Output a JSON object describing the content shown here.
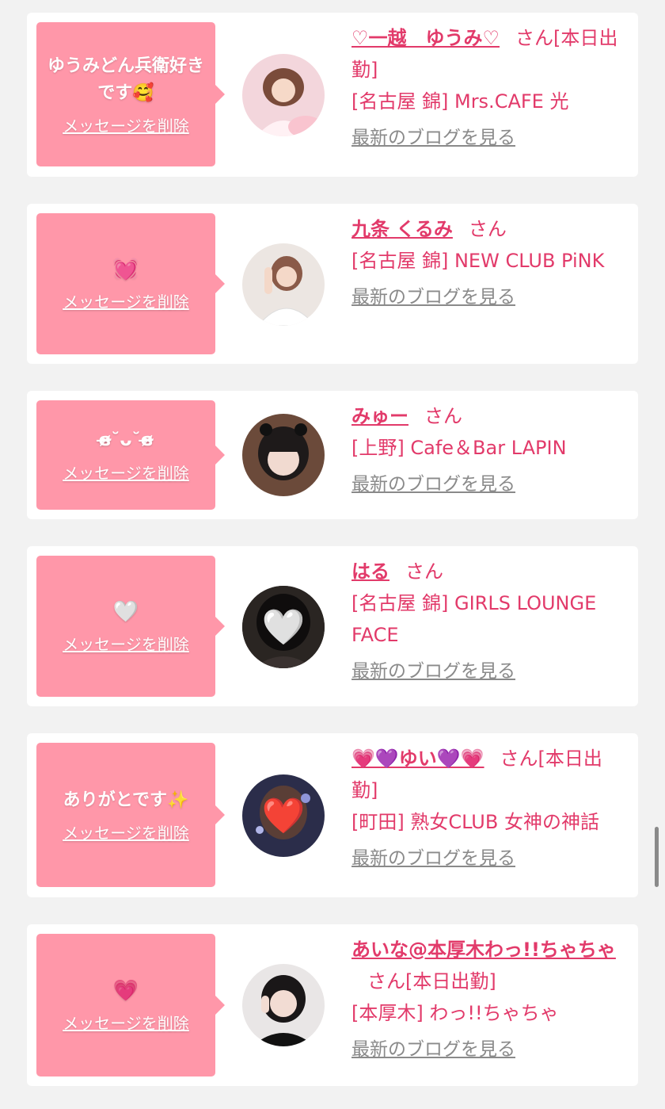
{
  "cards": [
    {
      "message": "ゆうみどん兵衛好きです🥰",
      "delete_label": "メッセージを削除",
      "name": "♡一越　ゆうみ♡",
      "honorific": "さん[本日出勤]",
      "shop": "[名古屋 錦] Mrs.CAFE 光",
      "blog_label": "最新のブログを見る",
      "avatar_icon": "woman-photo-icon",
      "avatar_bg": "#f3d6dc"
    },
    {
      "message": "💓",
      "delete_label": "メッセージを削除",
      "name": "九条 くるみ",
      "honorific": "さん",
      "shop": "[名古屋 錦] NEW CLUB PiNK",
      "blog_label": "最新のブログを見る",
      "avatar_icon": "woman-photo-icon",
      "avatar_bg": "#ece6e2"
    },
    {
      "message": "ɞ̴̶̷˘ᴗ˘ɞ̴̶̷",
      "delete_label": "メッセージを削除",
      "name": "みゅー",
      "honorific": "さん",
      "shop": "[上野] Cafe＆Bar LAPIN",
      "blog_label": "最新のブログを見る",
      "avatar_icon": "woman-photo-icon",
      "avatar_bg": "#6b4a3a"
    },
    {
      "message": "🤍",
      "delete_label": "メッセージを削除",
      "name": "はる",
      "honorific": "さん",
      "shop": "[名古屋 錦] GIRLS LOUNGE FACE",
      "blog_label": "最新のブログを見る",
      "avatar_icon": "white-heart-icon",
      "avatar_bg": "#2a2522",
      "avatar_overlay": "🤍"
    },
    {
      "message": "ありがとです✨",
      "delete_label": "メッセージを削除",
      "name": "💗💜ゆい💜💗",
      "honorific": "さん[本日出勤]",
      "shop": "[町田] 熟女CLUB 女神の神話",
      "blog_label": "最新のブログを見る",
      "avatar_icon": "red-heart-icon",
      "avatar_bg": "#2b2d4a",
      "avatar_overlay": "❤️"
    },
    {
      "message": "💗",
      "delete_label": "メッセージを削除",
      "name": "あいな@本厚木わっ!!ちゃちゃ",
      "honorific": "さん[本日出勤]",
      "shop": "[本厚木] わっ!!ちゃちゃ",
      "blog_label": "最新のブログを見る",
      "avatar_icon": "woman-photo-icon",
      "avatar_bg": "#3a3536"
    }
  ],
  "colors": {
    "accent": "#e23a6a",
    "bubble": "#ff97a9",
    "muted": "#8a8a8a",
    "background": "#f2f2f2"
  }
}
